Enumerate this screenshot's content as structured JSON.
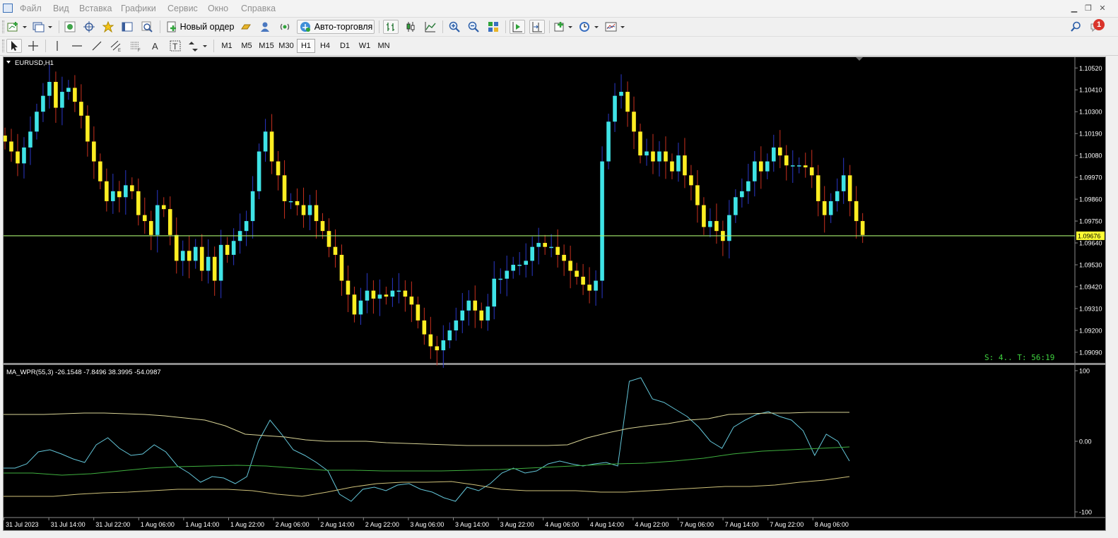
{
  "app": {
    "menu": [
      "Файл",
      "Вид",
      "Вставка",
      "Графики",
      "Сервис",
      "Окно",
      "Справка"
    ],
    "window_controls": [
      "minimize-icon",
      "restore-icon",
      "close-icon"
    ],
    "notifications_count": "1"
  },
  "toolbar": {
    "new_order_label": "Новый ордер",
    "autotrading_label": "Авто-торговля",
    "timeframes": [
      "M1",
      "M5",
      "M15",
      "M30",
      "H1",
      "H4",
      "D1",
      "W1",
      "MN"
    ],
    "active_timeframe": "H1"
  },
  "chart": {
    "symbol_label": "EURUSD,H1",
    "current_price": "1.09676",
    "spread_timer": "S: 4.. T: 56:19",
    "price_axis": [
      "1.10520",
      "1.10410",
      "1.10300",
      "1.10190",
      "1.10080",
      "1.09970",
      "1.09860",
      "1.09750",
      "1.09640",
      "1.09530",
      "1.09420",
      "1.09310",
      "1.09200",
      "1.09090"
    ],
    "time_axis": [
      "31 Jul 2023",
      "31 Jul 14:00",
      "31 Jul 22:00",
      "1 Aug 06:00",
      "1 Aug 14:00",
      "1 Aug 22:00",
      "2 Aug 06:00",
      "2 Aug 14:00",
      "2 Aug 22:00",
      "3 Aug 06:00",
      "3 Aug 14:00",
      "3 Aug 22:00",
      "4 Aug 06:00",
      "4 Aug 14:00",
      "4 Aug 22:00",
      "7 Aug 06:00",
      "7 Aug 14:00",
      "7 Aug 22:00",
      "8 Aug 06:00"
    ],
    "colors": {
      "bull": "#3fe3e6",
      "bear": "#ffee22",
      "wick_bull": "#2a38c8",
      "wick_bear": "#c8301e",
      "price_line": "#a8f070",
      "timer": "#3fd23f"
    }
  },
  "indicator": {
    "label": "MA_WPR(55,3) -26.1548 -7.8496 38.3995 -54.0987",
    "axis": [
      "100",
      "0.00",
      "-100"
    ]
  },
  "chart_data": [
    {
      "type": "candlestick",
      "title": "EURUSD,H1",
      "ylim": [
        1.0904,
        1.1056
      ],
      "closes": [
        1.1015,
        1.101,
        1.1004,
        1.1012,
        1.102,
        1.103,
        1.1038,
        1.1045,
        1.1032,
        1.104,
        1.1042,
        1.1035,
        1.1028,
        1.1015,
        1.1005,
        1.0995,
        1.0985,
        1.099,
        1.0987,
        1.0993,
        1.099,
        1.0978,
        1.0975,
        1.0968,
        1.0983,
        1.0981,
        1.0968,
        1.0955,
        1.096,
        1.0955,
        1.0962,
        1.095,
        1.0957,
        1.0945,
        1.0963,
        1.0958,
        1.0965,
        1.097,
        1.0975,
        1.099,
        1.101,
        1.102,
        1.1005,
        1.0998,
        1.0985,
        1.0985,
        1.0983,
        1.0978,
        1.0983,
        1.0975,
        1.097,
        1.0962,
        1.0958,
        1.0945,
        1.0938,
        1.0928,
        1.0935,
        1.094,
        1.0936,
        1.0938,
        1.0937,
        1.094,
        1.094,
        1.0937,
        1.0933,
        1.0925,
        1.0918,
        1.0912,
        1.091,
        1.0915,
        1.092,
        1.0925,
        1.093,
        1.0935,
        1.093,
        1.0925,
        1.0932,
        1.0946,
        1.0946,
        1.095,
        1.0953,
        1.0953,
        1.0955,
        1.0962,
        1.0964,
        1.0962,
        1.0962,
        1.0958,
        1.0955,
        1.095,
        1.0947,
        1.0943,
        1.094,
        1.0945,
        1.1005,
        1.1025,
        1.1038,
        1.104,
        1.103,
        1.102,
        1.1008,
        1.101,
        1.1005,
        1.101,
        1.1005,
        1.1,
        1.1008,
        1.0998,
        1.0993,
        1.0983,
        1.0972,
        1.0975,
        1.097,
        1.0965,
        1.0978,
        1.0987,
        1.099,
        1.0995,
        1.1005,
        1.1,
        1.1005,
        1.1012,
        1.1008,
        1.1003,
        1.1003,
        1.1003,
        1.1002,
        1.0998,
        1.0985,
        1.0978,
        1.0985,
        1.099,
        1.0998,
        1.0985,
        1.0975,
        1.0968
      ],
      "current_price": 1.09676
    },
    {
      "type": "line",
      "title": "MA_WPR(55,3)",
      "ylim": [
        -100,
        100
      ],
      "series": [
        {
          "values": [
            -38,
            -38,
            -32,
            -15,
            -12,
            -18,
            -25,
            -30,
            -5,
            5,
            -10,
            -20,
            -18,
            -5,
            -15,
            -35,
            -45,
            -58,
            -50,
            -52,
            -60,
            -50,
            0,
            30,
            10,
            -12,
            -20,
            -30,
            -42,
            -75,
            -85,
            -68,
            -65,
            -70,
            -62,
            -60,
            -68,
            -72,
            -80,
            -85,
            -65,
            -70,
            -60,
            -45,
            -38,
            -45,
            -42,
            -32,
            -28,
            -32,
            -35,
            -32,
            -30,
            -35,
            85,
            90,
            60,
            55,
            45,
            35,
            20,
            0,
            -10,
            20,
            30,
            38,
            42,
            35,
            30,
            15,
            -20,
            10,
            0,
            -28
          ]
        },
        {
          "values": [
            38,
            38,
            38,
            39,
            40,
            40,
            39,
            38,
            36,
            33,
            30,
            22,
            10,
            8,
            6,
            2,
            0,
            0,
            0,
            -2,
            -3,
            -4,
            -5,
            -6,
            -6,
            -6,
            -6,
            -6,
            -5,
            5,
            12,
            18,
            22,
            25,
            30,
            32,
            38,
            39,
            40,
            40,
            41,
            41,
            41
          ]
        },
        {
          "values": [
            -45,
            -45,
            -48,
            -46,
            -42,
            -38,
            -36,
            -35,
            -34,
            -35,
            -38,
            -41,
            -41,
            -42,
            -42,
            -42,
            -41,
            -40,
            -38,
            -36,
            -34,
            -32,
            -31,
            -28,
            -24,
            -18,
            -14,
            -12,
            -10,
            -8
          ]
        },
        {
          "values": [
            -78,
            -78,
            -78,
            -75,
            -73,
            -72,
            -70,
            -68,
            -68,
            -68,
            -70,
            -75,
            -78,
            -72,
            -65,
            -60,
            -58,
            -58,
            -57,
            -62,
            -68,
            -70,
            -70,
            -70,
            -72,
            -72,
            -70,
            -68,
            -66,
            -64,
            -64,
            -62,
            -58,
            -55,
            -50
          ]
        }
      ]
    }
  ]
}
